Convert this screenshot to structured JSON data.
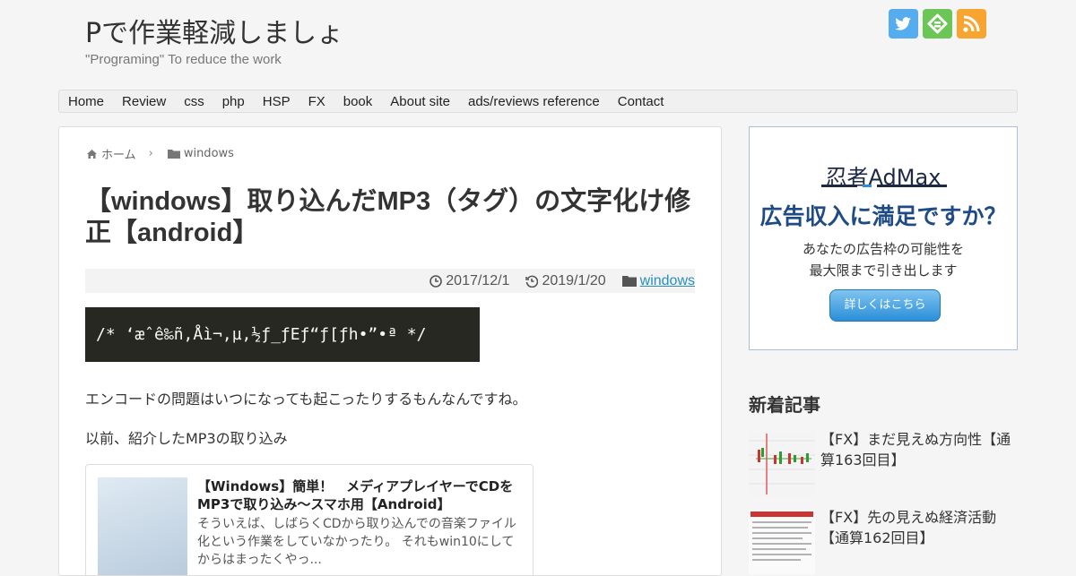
{
  "header": {
    "title": "Pで作業軽減しましょ",
    "tagline": "\"Programing\" To reduce the work"
  },
  "social": {
    "icons": [
      "twitter-icon",
      "feedly-icon",
      "rss-icon"
    ],
    "colors": [
      "#55acee",
      "#6cc655",
      "#f7a530"
    ]
  },
  "nav": {
    "items": [
      "Home",
      "Review",
      "css",
      "php",
      "HSP",
      "FX",
      "book",
      "About site",
      "ads/reviews reference",
      "Contact"
    ]
  },
  "breadcrumb": {
    "home": "ホーム",
    "category": "windows"
  },
  "article": {
    "title": "【windows】取り込んだMP3（タグ）の文字化け修正【android】",
    "published": "2017/12/1",
    "updated": "2019/1/20",
    "category": "windows",
    "code": "/* ‘æˆê‰ñ‚Åì¬‚µ‚½ƒ_ƒEƒ“ƒ[ƒh•”•ª */",
    "p1": "エンコードの問題はいつになっても起こったりするもんなんですね。",
    "p2": "以前、紹介したMP3の取り込み",
    "card": {
      "title": "【Windows】簡単！　メディアプレイヤーでCDをMP3で取り込み～スマホ用【Android】",
      "desc": "そういえば、しばらくCDから取り込んでの音楽ファイル化という作業をしていなかったり。 それもwin10にしてからはまったくやっ..."
    }
  },
  "ad": {
    "brand": "忍者AdMax",
    "headline": "広告収入に満足ですか？",
    "line1": "あなたの広告枠の可能性を",
    "line2": "最大限まで引き出します",
    "button": "詳しくはこちら"
  },
  "sidebar": {
    "heading": "新着記事",
    "posts": [
      {
        "title": "【FX】まだ見えぬ方向性【通算163回目】"
      },
      {
        "title": "【FX】先の見えぬ経済活動【通算162回目】"
      }
    ]
  }
}
